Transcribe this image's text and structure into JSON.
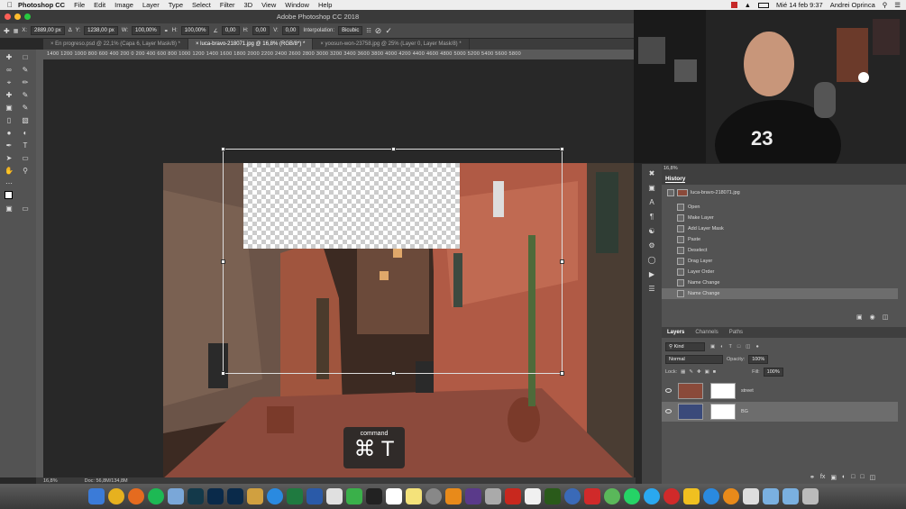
{
  "menubar": {
    "app": "Photoshop CC",
    "items": [
      "File",
      "Edit",
      "Image",
      "Layer",
      "Type",
      "Select",
      "Filter",
      "3D",
      "View",
      "Window",
      "Help"
    ],
    "clock": "Mié 14 feb 9:37",
    "user": "Andrei Oprinca"
  },
  "window": {
    "title": "Adobe Photoshop CC 2018"
  },
  "options": {
    "x_label": "X:",
    "x": "2889,00 px",
    "y_label": "Y:",
    "y": "1238,00 px",
    "w_label": "W:",
    "w": "100,00%",
    "h_label": "H:",
    "h": "100,00%",
    "angle": "0,00",
    "hskew_label": "H:",
    "hskew": "0,00",
    "vskew_label": "V:",
    "vskew": "0,00",
    "interp_label": "Interpolation:",
    "interp": "Bicubic"
  },
  "tabs": [
    {
      "label": "En progreso.psd @ 22,1% (Capa 6, Layer Mask/8) *"
    },
    {
      "label": "luca-bravo-218071.jpg @ 16,8% (RGB/8*) *"
    },
    {
      "label": "yoosun-won-23758.jpg @ 25% (Layer 0, Layer Mask/8) *"
    }
  ],
  "ruler": {
    "text": "1400  1200  1000  800  600  400  200  0  200  400  600  800  1000  1200  1400  1600  1800  2000  2200  2400  2600  2800  3000  3200  3400  3600  3800  4000  4200  4400  4600  4800  5000  5200  5400  5600  5800"
  },
  "shortcut": {
    "label": "command",
    "keys": "⌘ T"
  },
  "status": {
    "zoom": "16,8%",
    "doc": "Doc: 56,8M/134,8M"
  },
  "panel_zoom": "16,8%",
  "history": {
    "title": "History",
    "snapshot": "luca-bravo-218071.jpg",
    "states": [
      "Open",
      "Make Layer",
      "Add Layer Mask",
      "Paste",
      "Deselect",
      "Drag Layer",
      "Layer Order",
      "Name Change",
      "Name Change"
    ]
  },
  "layers": {
    "tabs": [
      "Layers",
      "Channels",
      "Paths"
    ],
    "kind": "Kind",
    "blend": "Normal",
    "opacity_label": "Opacity:",
    "opacity": "100%",
    "lock_label": "Lock:",
    "fill_label": "Fill:",
    "fill": "100%",
    "items": [
      {
        "name": "street"
      },
      {
        "name": "BG"
      }
    ]
  },
  "colors": {
    "accent": "#2d8ceb",
    "panel": "#535353",
    "toolbar": "#535353"
  },
  "dock": [
    "Finder",
    "Chrome",
    "Firefox",
    "Spotify",
    "Tweetbot",
    "Lr",
    "Ps",
    "Ps",
    "Preview",
    "Safari",
    "X",
    "W",
    "Pages",
    "Camtasia",
    "Terminal",
    "14",
    "Notes",
    "Preferences",
    "VLC",
    "iMovie",
    "Archive",
    "FileZilla",
    "TextEdit",
    "Dw",
    "Thunderbird",
    "PDF",
    "Maps",
    "WhatsApp",
    "Messages",
    "Photo Booth",
    "Vectornator",
    "Xcode",
    "Automator",
    "Downloads",
    "Folder",
    "Folder",
    "Trash"
  ]
}
